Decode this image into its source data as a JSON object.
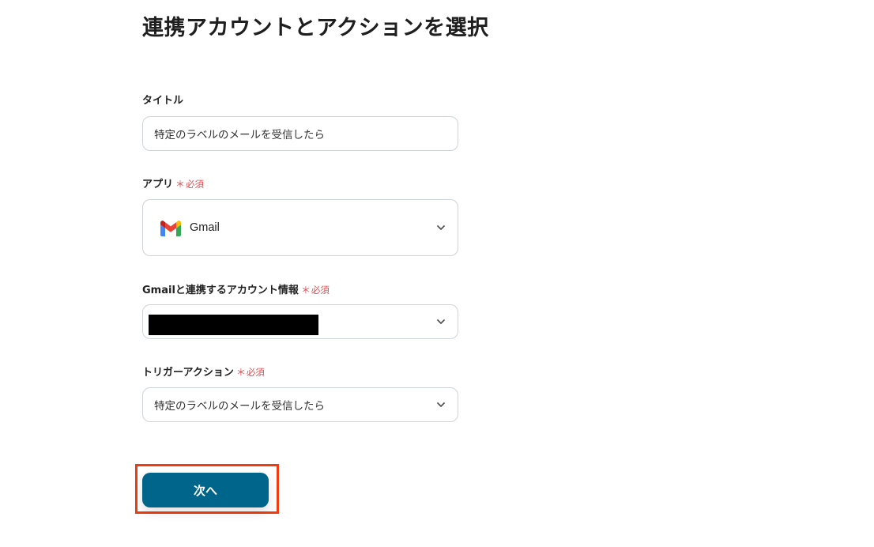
{
  "page": {
    "title": "連携アカウントとアクションを選択"
  },
  "form": {
    "title_field": {
      "label": "タイトル",
      "value": "特定のラベルのメールを受信したら"
    },
    "app_field": {
      "label": "アプリ",
      "required_mark": "＊",
      "required_text": "必須",
      "selected_app": "Gmail",
      "app_icon": "gmail-logo",
      "chevron_icon": "chevron-down-icon"
    },
    "account_field": {
      "label": "Gmailと連携するアカウント情報",
      "required_mark": "＊",
      "required_text": "必須",
      "chevron_icon": "chevron-down-icon"
    },
    "trigger_field": {
      "label": "トリガーアクション",
      "required_mark": "＊",
      "required_text": "必須",
      "selected_value": "特定のラベルのメールを受信したら",
      "chevron_icon": "chevron-down-icon"
    },
    "next_button": {
      "label": "次へ"
    }
  },
  "colors": {
    "primary_button": "#00658a",
    "required": "#e5484d",
    "highlight_border": "#f03c0f",
    "field_border": "#cfd4da"
  }
}
